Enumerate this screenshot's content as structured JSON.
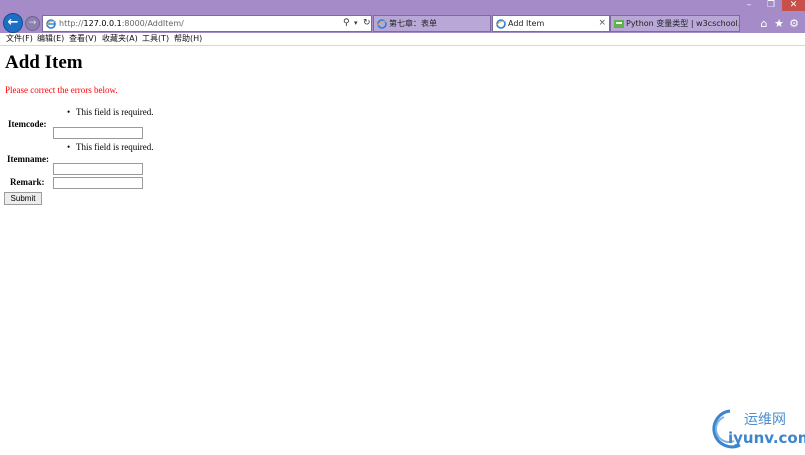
{
  "browser": {
    "window_controls": {
      "minimize": "–",
      "maximize": "❐",
      "close": "✕"
    },
    "back_glyph": "←",
    "forward_glyph": "→",
    "address": {
      "prefix": "http://",
      "host": "127.0.0.1",
      "rest": ":8000/AddItem/"
    },
    "address_icons": {
      "search": "⚲",
      "dropdown": "▾",
      "refresh": "↻"
    },
    "tabs": [
      {
        "label": "第七章：表单",
        "active": false
      },
      {
        "label": "Add Item",
        "active": true,
        "close": "×"
      },
      {
        "label": "Python 变量类型 | w3cschool...",
        "active": false
      }
    ],
    "tool_icons": {
      "home": "⌂",
      "favorites": "★",
      "settings": "⚙"
    },
    "menu": [
      "文件(F)",
      "编辑(E)",
      "查看(V)",
      "收藏夹(A)",
      "工具(T)",
      "帮助(H)"
    ]
  },
  "page": {
    "title": "Add Item",
    "error_note": "Please correct the errors below.",
    "bullet": "•",
    "fields": {
      "itemcode": {
        "label": "Itemcode:",
        "error": "This field is required.",
        "value": ""
      },
      "itemname": {
        "label": "Itemname:",
        "error": "This field is required.",
        "value": ""
      },
      "remark": {
        "label": "Remark:",
        "value": ""
      }
    },
    "submit_label": "Submit"
  },
  "watermark": {
    "brand": "运维网",
    "url": "iyunv.com"
  },
  "colors": {
    "chrome": "#a58cc9",
    "error": "#ff0000",
    "accent": "#1d6fc4"
  }
}
